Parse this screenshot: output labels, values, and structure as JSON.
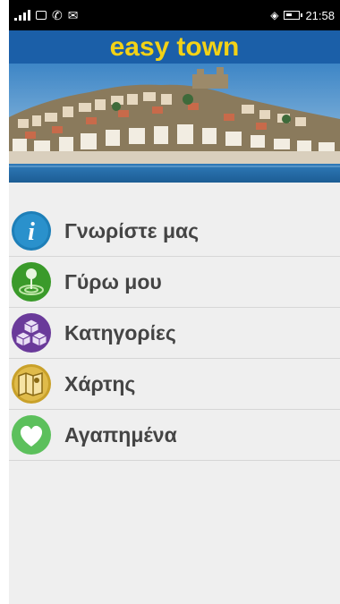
{
  "status_bar": {
    "time": "21:58",
    "icons": [
      "signal-icon",
      "image-icon",
      "whatsapp-icon",
      "mail-icon",
      "wifi-icon",
      "battery-icon"
    ]
  },
  "app": {
    "brand_left": "easy",
    "brand_right": "town",
    "brand_color": "#f3d216",
    "header_color": "#1b5fa8"
  },
  "menu": {
    "items": [
      {
        "label": "Γνωρίστε μας",
        "icon": "info-icon",
        "color": "#1e7fb8"
      },
      {
        "label": "Γύρω μου",
        "icon": "location-pin-icon",
        "color": "#3a9a2a"
      },
      {
        "label": "Κατηγορίες",
        "icon": "cubes-icon",
        "color": "#6a3a9a"
      },
      {
        "label": "Χάρτης",
        "icon": "map-icon",
        "color": "#c9a12a"
      },
      {
        "label": "Αγαπημένα",
        "icon": "heart-icon",
        "color": "#5cc05c"
      }
    ]
  }
}
